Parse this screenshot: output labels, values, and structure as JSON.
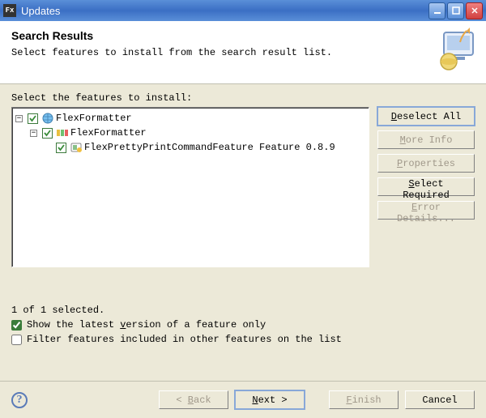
{
  "window": {
    "title": "Updates"
  },
  "header": {
    "title": "Search Results",
    "subtitle": "Select features to install from the search result list."
  },
  "main": {
    "instruction": "Select the features to install:",
    "tree": {
      "root_label": "FlexFormatter",
      "group_label": "FlexFormatter",
      "feature_label": "FlexPrettyPrintCommandFeature Feature 0.8.9"
    }
  },
  "side": {
    "deselect_all": "Deselect All",
    "more_info": "More Info",
    "properties": "Properties",
    "select_required": "Select Required",
    "error_details": "Error Details..."
  },
  "status": {
    "selected": "1 of 1 selected.",
    "show_latest": "Show the latest version of a feature only",
    "filter_included": "Filter features included in other features on the list"
  },
  "footer": {
    "back": "< Back",
    "next": "Next >",
    "finish": "Finish",
    "cancel": "Cancel"
  }
}
